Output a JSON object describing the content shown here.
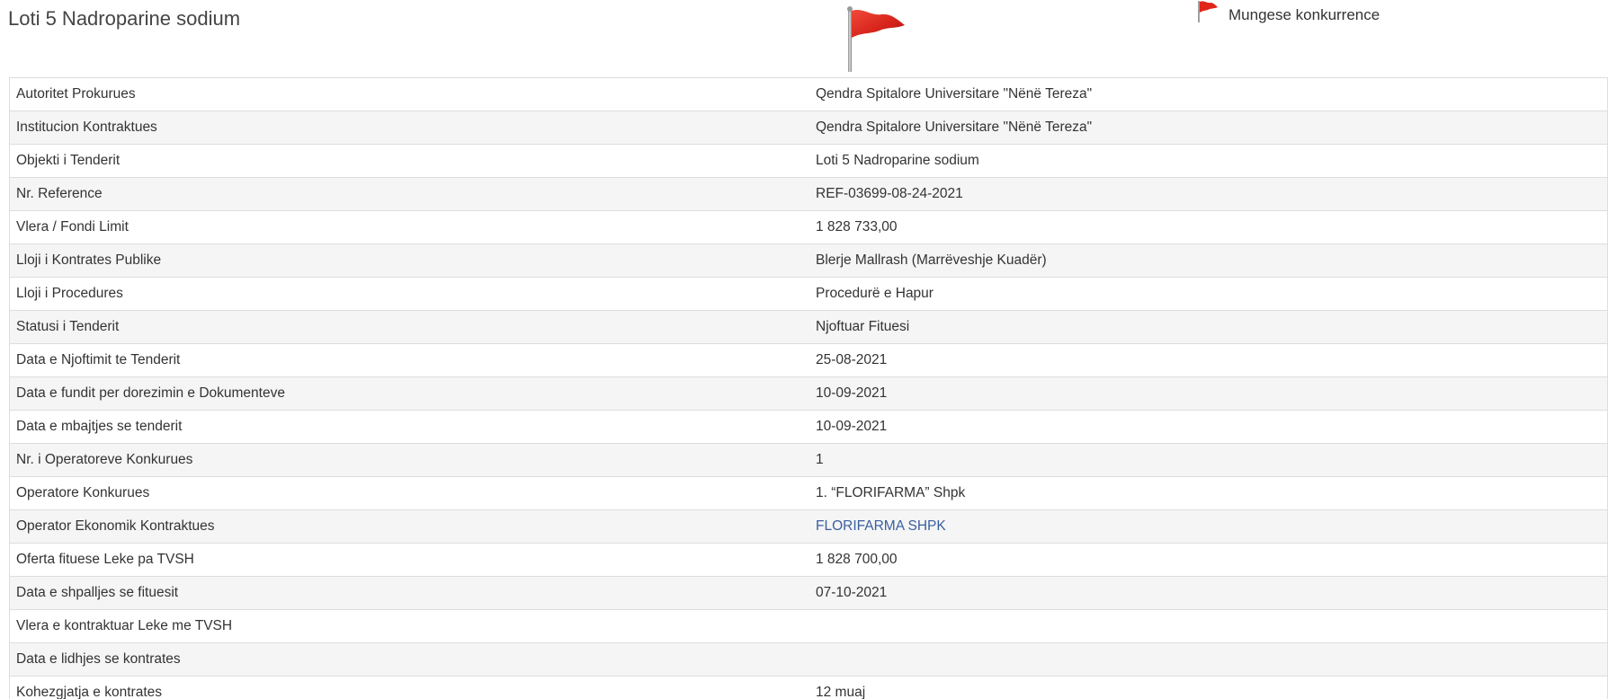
{
  "page": {
    "title": "Loti 5 Nadroparine sodium",
    "legend_label": "Mungese konkurrence"
  },
  "colors": {
    "flag": "#e0251b",
    "link": "#3a5fa0",
    "row_alt": "#f5f5f5",
    "border": "#dddddd"
  },
  "icons": {
    "status_flag": "red-flag-icon",
    "legend_flag": "red-flag-icon"
  },
  "details": {
    "rows": [
      {
        "label": "Autoritet Prokurues",
        "value": "Qendra Spitalore Universitare \"Nënë Tereza\""
      },
      {
        "label": "Institucion Kontraktues",
        "value": "Qendra Spitalore Universitare \"Nënë Tereza\""
      },
      {
        "label": "Objekti i Tenderit",
        "value": "Loti 5 Nadroparine sodium"
      },
      {
        "label": "Nr. Reference",
        "value": "REF-03699-08-24-2021"
      },
      {
        "label": "Vlera / Fondi Limit",
        "value": "1 828 733,00"
      },
      {
        "label": "Lloji i Kontrates Publike",
        "value": "Blerje Mallrash (Marrëveshje Kuadër)"
      },
      {
        "label": "Lloji i Procedures",
        "value": "Procedurë e Hapur"
      },
      {
        "label": "Statusi i Tenderit",
        "value": "Njoftuar Fituesi"
      },
      {
        "label": "Data e Njoftimit te Tenderit",
        "value": "25-08-2021"
      },
      {
        "label": "Data e fundit per dorezimin e Dokumenteve",
        "value": "10-09-2021"
      },
      {
        "label": "Data e mbajtjes se tenderit",
        "value": "10-09-2021"
      },
      {
        "label": "Nr. i Operatoreve Konkurues",
        "value": "1"
      },
      {
        "label": "Operatore Konkurues",
        "value": "1. “FLORIFARMA” Shpk"
      },
      {
        "label": "Operator Ekonomik Kontraktues",
        "value": "FLORIFARMA SHPK"
      },
      {
        "label": "Oferta fituese Leke pa TVSH",
        "value": "1 828 700,00"
      },
      {
        "label": "Data e shpalljes se fituesit",
        "value": "07-10-2021"
      },
      {
        "label": "Vlera e kontraktuar Leke me TVSH",
        "value": ""
      },
      {
        "label": "Data e lidhjes se kontrates",
        "value": ""
      },
      {
        "label": "Kohezgjatja e kontrates",
        "value": "12 muaj"
      }
    ]
  }
}
